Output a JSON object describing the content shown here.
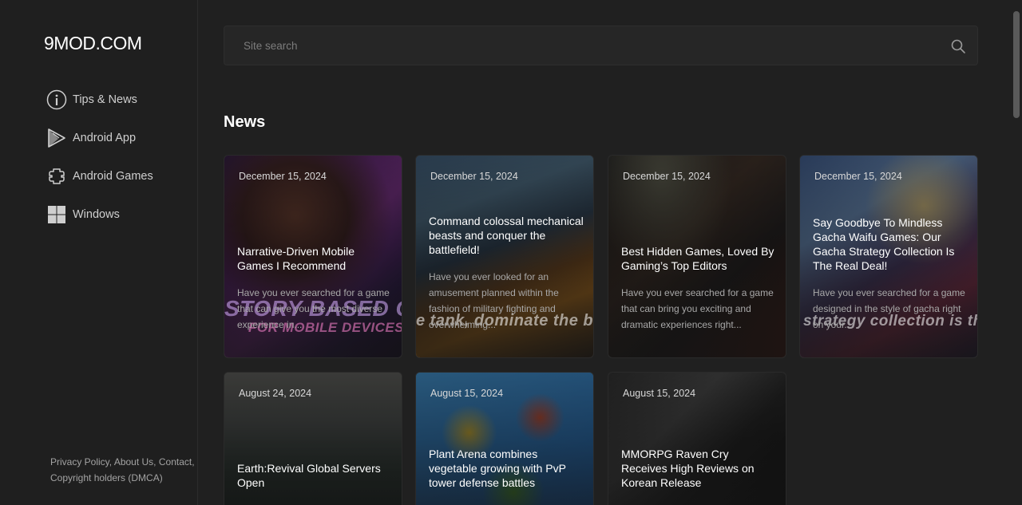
{
  "logo": "9MOD.COM",
  "nav": [
    {
      "label": "Tips & News",
      "icon": "info-icon"
    },
    {
      "label": "Android App",
      "icon": "play-store-icon"
    },
    {
      "label": "Android Games",
      "icon": "gamepad-icon"
    },
    {
      "label": "Windows",
      "icon": "windows-icon"
    }
  ],
  "footer": {
    "privacy": "Privacy Policy,",
    "about": "About Us,",
    "contact": "Contact,",
    "copyright": "Copyright holders (DMCA)"
  },
  "search": {
    "placeholder": "Site search"
  },
  "section_title": "News",
  "cards": [
    {
      "date": "December 15, 2024",
      "title": "Narrative-Driven Mobile Games I Recommend",
      "excerpt": "Have you ever searched for a game that can give you the most diverse experience in...",
      "overlay": "STORY BASED G / FOR MOBILE DEVICES"
    },
    {
      "date": "December 15, 2024",
      "title": "Command colossal mechanical beasts and conquer the battlefield!",
      "excerpt": "Have you ever looked for an amusement planned within the fashion of military fighting and overwhelming...",
      "overlay": "e tank, dominate the bat"
    },
    {
      "date": "December 15, 2024",
      "title": "Best Hidden Games, Loved By Gaming’s Top Editors",
      "excerpt": "Have you ever searched for a game that can bring you exciting and dramatic experiences right...",
      "overlay": ""
    },
    {
      "date": "December 15, 2024",
      "title": "Say Goodbye To Mindless Gacha Waifu Games: Our Gacha Strategy Collection Is The Real Deal!",
      "excerpt": "Have you ever searched for a game designed in the style of gacha right on your...",
      "overlay": "strategy collection is th"
    },
    {
      "date": "August 24, 2024",
      "title": "Earth:Revival Global Servers Open",
      "excerpt": "",
      "overlay": ""
    },
    {
      "date": "August 15, 2024",
      "title": "Plant Arena combines vegetable growing with PvP tower defense battles",
      "excerpt": "",
      "overlay": ""
    },
    {
      "date": "August 15, 2024",
      "title": "MMORPG Raven Cry Receives High Reviews on Korean Release",
      "excerpt": "",
      "overlay": ""
    }
  ]
}
